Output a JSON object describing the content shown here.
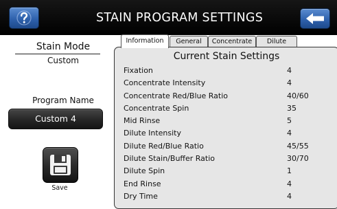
{
  "header": {
    "title": "STAIN PROGRAM SETTINGS",
    "help_icon": "question-mark-icon",
    "back_icon": "back-arrow-icon"
  },
  "left": {
    "stain_mode_label": "Stain Mode",
    "stain_mode_value": "Custom",
    "program_name_label": "Program Name",
    "program_name_value": "Custom 4",
    "save_label": "Save",
    "save_icon": "floppy-disk-icon"
  },
  "tabs": [
    {
      "label": "Information",
      "active": true
    },
    {
      "label": "General",
      "active": false
    },
    {
      "label": "Concentrate",
      "active": false
    },
    {
      "label": "Dilute",
      "active": false
    }
  ],
  "panel": {
    "title": "Current Stain Settings",
    "rows": [
      {
        "name": "Fixation",
        "value": "4"
      },
      {
        "name": "Concentrate Intensity",
        "value": "4"
      },
      {
        "name": "Concentrate Red/Blue Ratio",
        "value": "40/60"
      },
      {
        "name": "Concentrate Spin",
        "value": "35"
      },
      {
        "name": "Mid Rinse",
        "value": "5"
      },
      {
        "name": "Dilute Intensity",
        "value": "4"
      },
      {
        "name": "Dilute Red/Blue Ratio",
        "value": "45/55"
      },
      {
        "name": "Dilute Stain/Buffer Ratio",
        "value": "30/70"
      },
      {
        "name": "Dilute Spin",
        "value": "1"
      },
      {
        "name": "End Rinse",
        "value": "4"
      },
      {
        "name": "Dry Time",
        "value": "4"
      }
    ]
  },
  "colors": {
    "header_bg": "#000000",
    "button_blue": "#2f62ad",
    "panel_bg": "#e6e6e6",
    "program_button_bg": "#262626"
  }
}
